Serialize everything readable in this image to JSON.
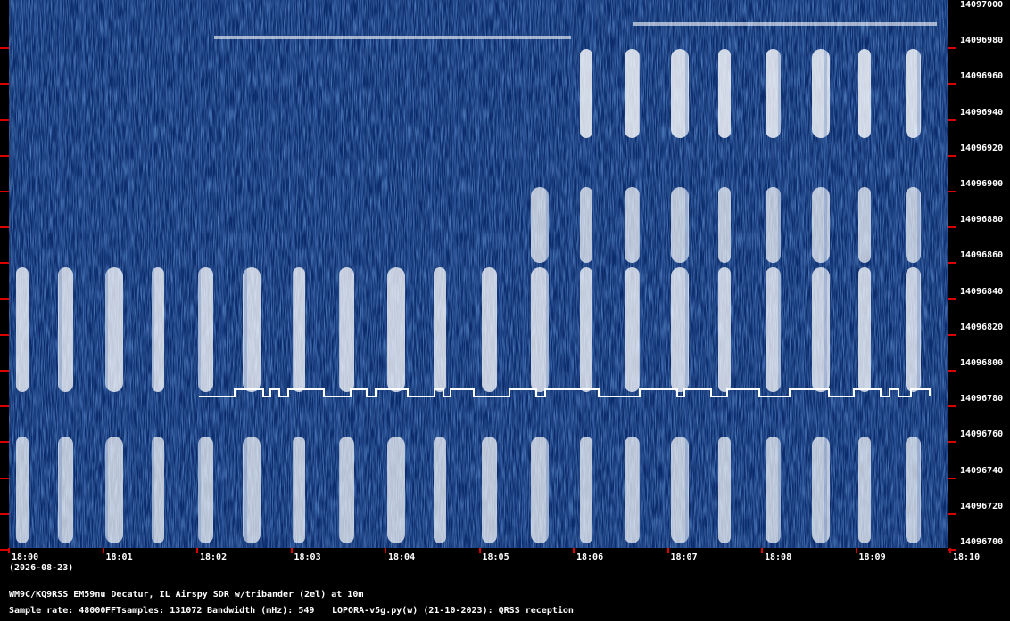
{
  "header": {
    "date": "(2026-08-23)",
    "station_line": "WM9C/KQ9RSS EM59nu Decatur, IL  Airspy SDR w/tribander (2el) at 10m",
    "sample_rate_label": "Sample rate: 48000",
    "fft_samples_label": "FFTsamples: 131072",
    "bandwidth_label": "Bandwidth (mHz): 549",
    "software_label": "LOPORA-v5g.py(w) (21-10-2023): QRSS reception"
  },
  "axes": {
    "frequency_labels": [
      "14097000",
      "14096980",
      "14096960",
      "14096940",
      "14096920",
      "14096900",
      "14096880",
      "14096860",
      "14096840",
      "14096820",
      "14096800",
      "14096780",
      "14096760",
      "14096740",
      "14096720",
      "14096700"
    ],
    "time_labels": [
      "18:00",
      "18:01",
      "18:02",
      "18:03",
      "18:04",
      "18:05",
      "18:06",
      "18:07",
      "18:08",
      "18:09",
      "18:10"
    ]
  },
  "colors": {
    "background": "#000000",
    "spectrogram_base": "#0b2b6a",
    "signal": "#ffffff",
    "tick": "#dd0000"
  }
}
